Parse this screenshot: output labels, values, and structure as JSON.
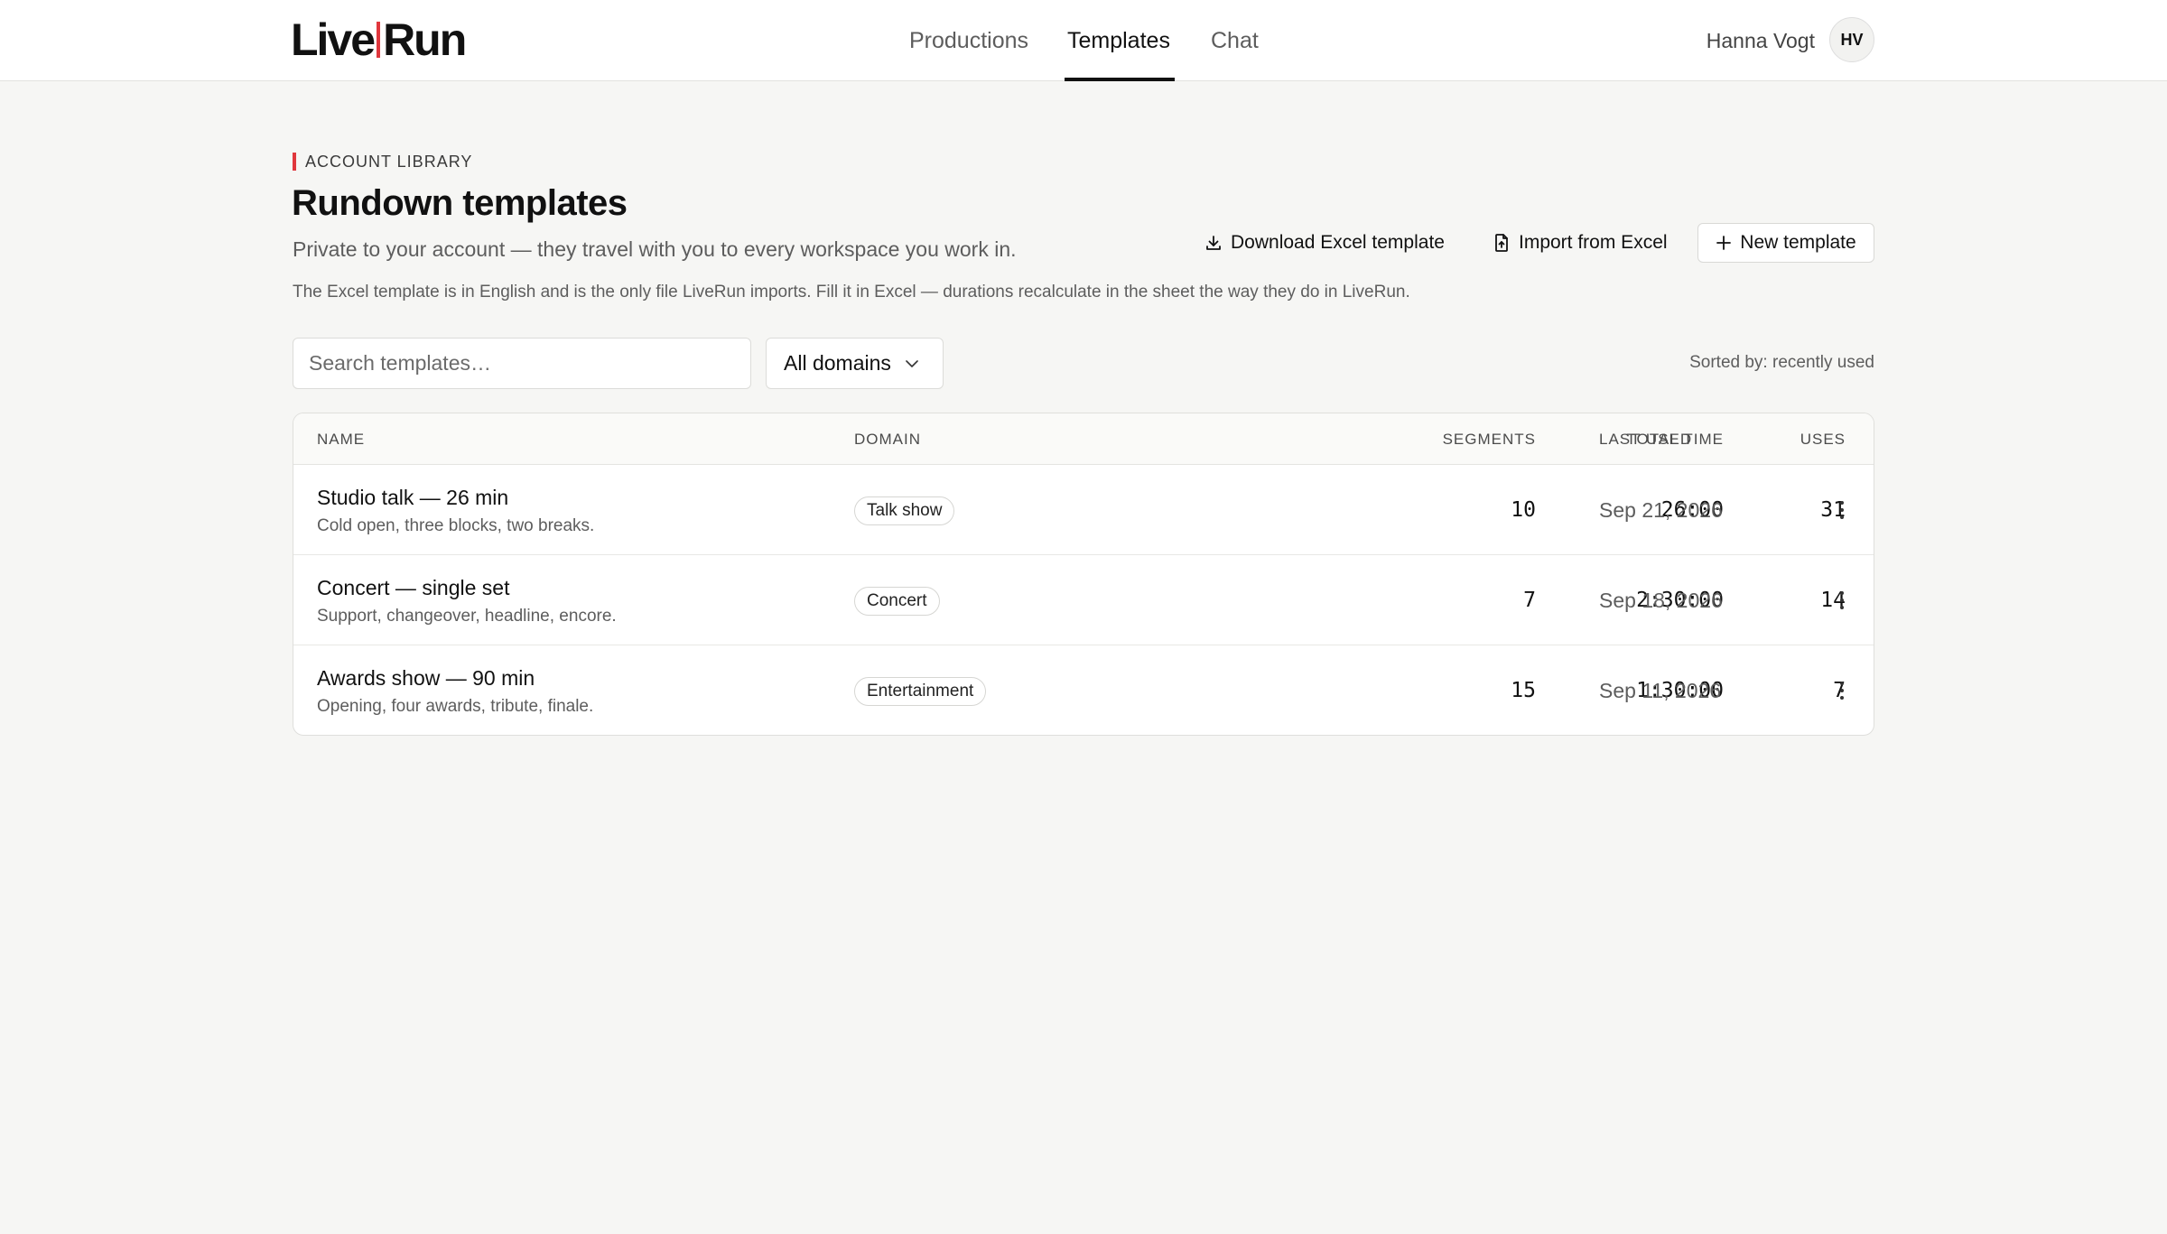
{
  "brand": {
    "part1": "Live",
    "part2": "Run"
  },
  "nav": {
    "items": [
      {
        "label": "Productions",
        "active": false
      },
      {
        "label": "Templates",
        "active": true
      },
      {
        "label": "Chat",
        "active": false
      }
    ]
  },
  "user": {
    "name": "Hanna Vogt",
    "initials": "HV"
  },
  "header": {
    "eyebrow": "ACCOUNT LIBRARY",
    "title": "Rundown templates",
    "subtitle": "Private to your account — they travel with you to every workspace you work in.",
    "note": "The Excel template is in English and is the only file LiveRun imports. Fill it in Excel — durations recalculate in the sheet the way they do in LiveRun."
  },
  "actions": {
    "download_label": "Download Excel template",
    "import_label": "Import from Excel",
    "new_label": "New template"
  },
  "filters": {
    "search_placeholder": "Search templates…",
    "domain_selected": "All domains",
    "sorted_label": "Sorted by: recently used"
  },
  "table": {
    "columns": {
      "name": "NAME",
      "domain": "DOMAIN",
      "segments": "SEGMENTS",
      "total_time": "TOTAL TIME",
      "uses": "USES",
      "last_used": "LAST USED"
    },
    "rows": [
      {
        "name": "Studio talk — 26 min",
        "description": "Cold open, three blocks, two breaks.",
        "domain": "Talk show",
        "segments": "10",
        "total_time": "26:00",
        "uses": "31",
        "last_used": "Sep 21, 2026"
      },
      {
        "name": "Concert — single set",
        "description": "Support, changeover, headline, encore.",
        "domain": "Concert",
        "segments": "7",
        "total_time": "2:30:00",
        "uses": "14",
        "last_used": "Sep 18, 2026"
      },
      {
        "name": "Awards show — 90 min",
        "description": "Opening, four awards, tribute, finale.",
        "domain": "Entertainment",
        "segments": "15",
        "total_time": "1:30:00",
        "uses": "7",
        "last_used": "Sep 11, 2026"
      }
    ]
  },
  "colors": {
    "accent": "#e0373d",
    "background": "#f6f6f4",
    "text": "#141414",
    "muted": "#5d5d5d"
  },
  "icons": {
    "download": "download-icon",
    "import": "file-import-icon",
    "new": "plus-icon",
    "select": "chevron-down-icon",
    "row_menu": "more-vertical-icon"
  }
}
